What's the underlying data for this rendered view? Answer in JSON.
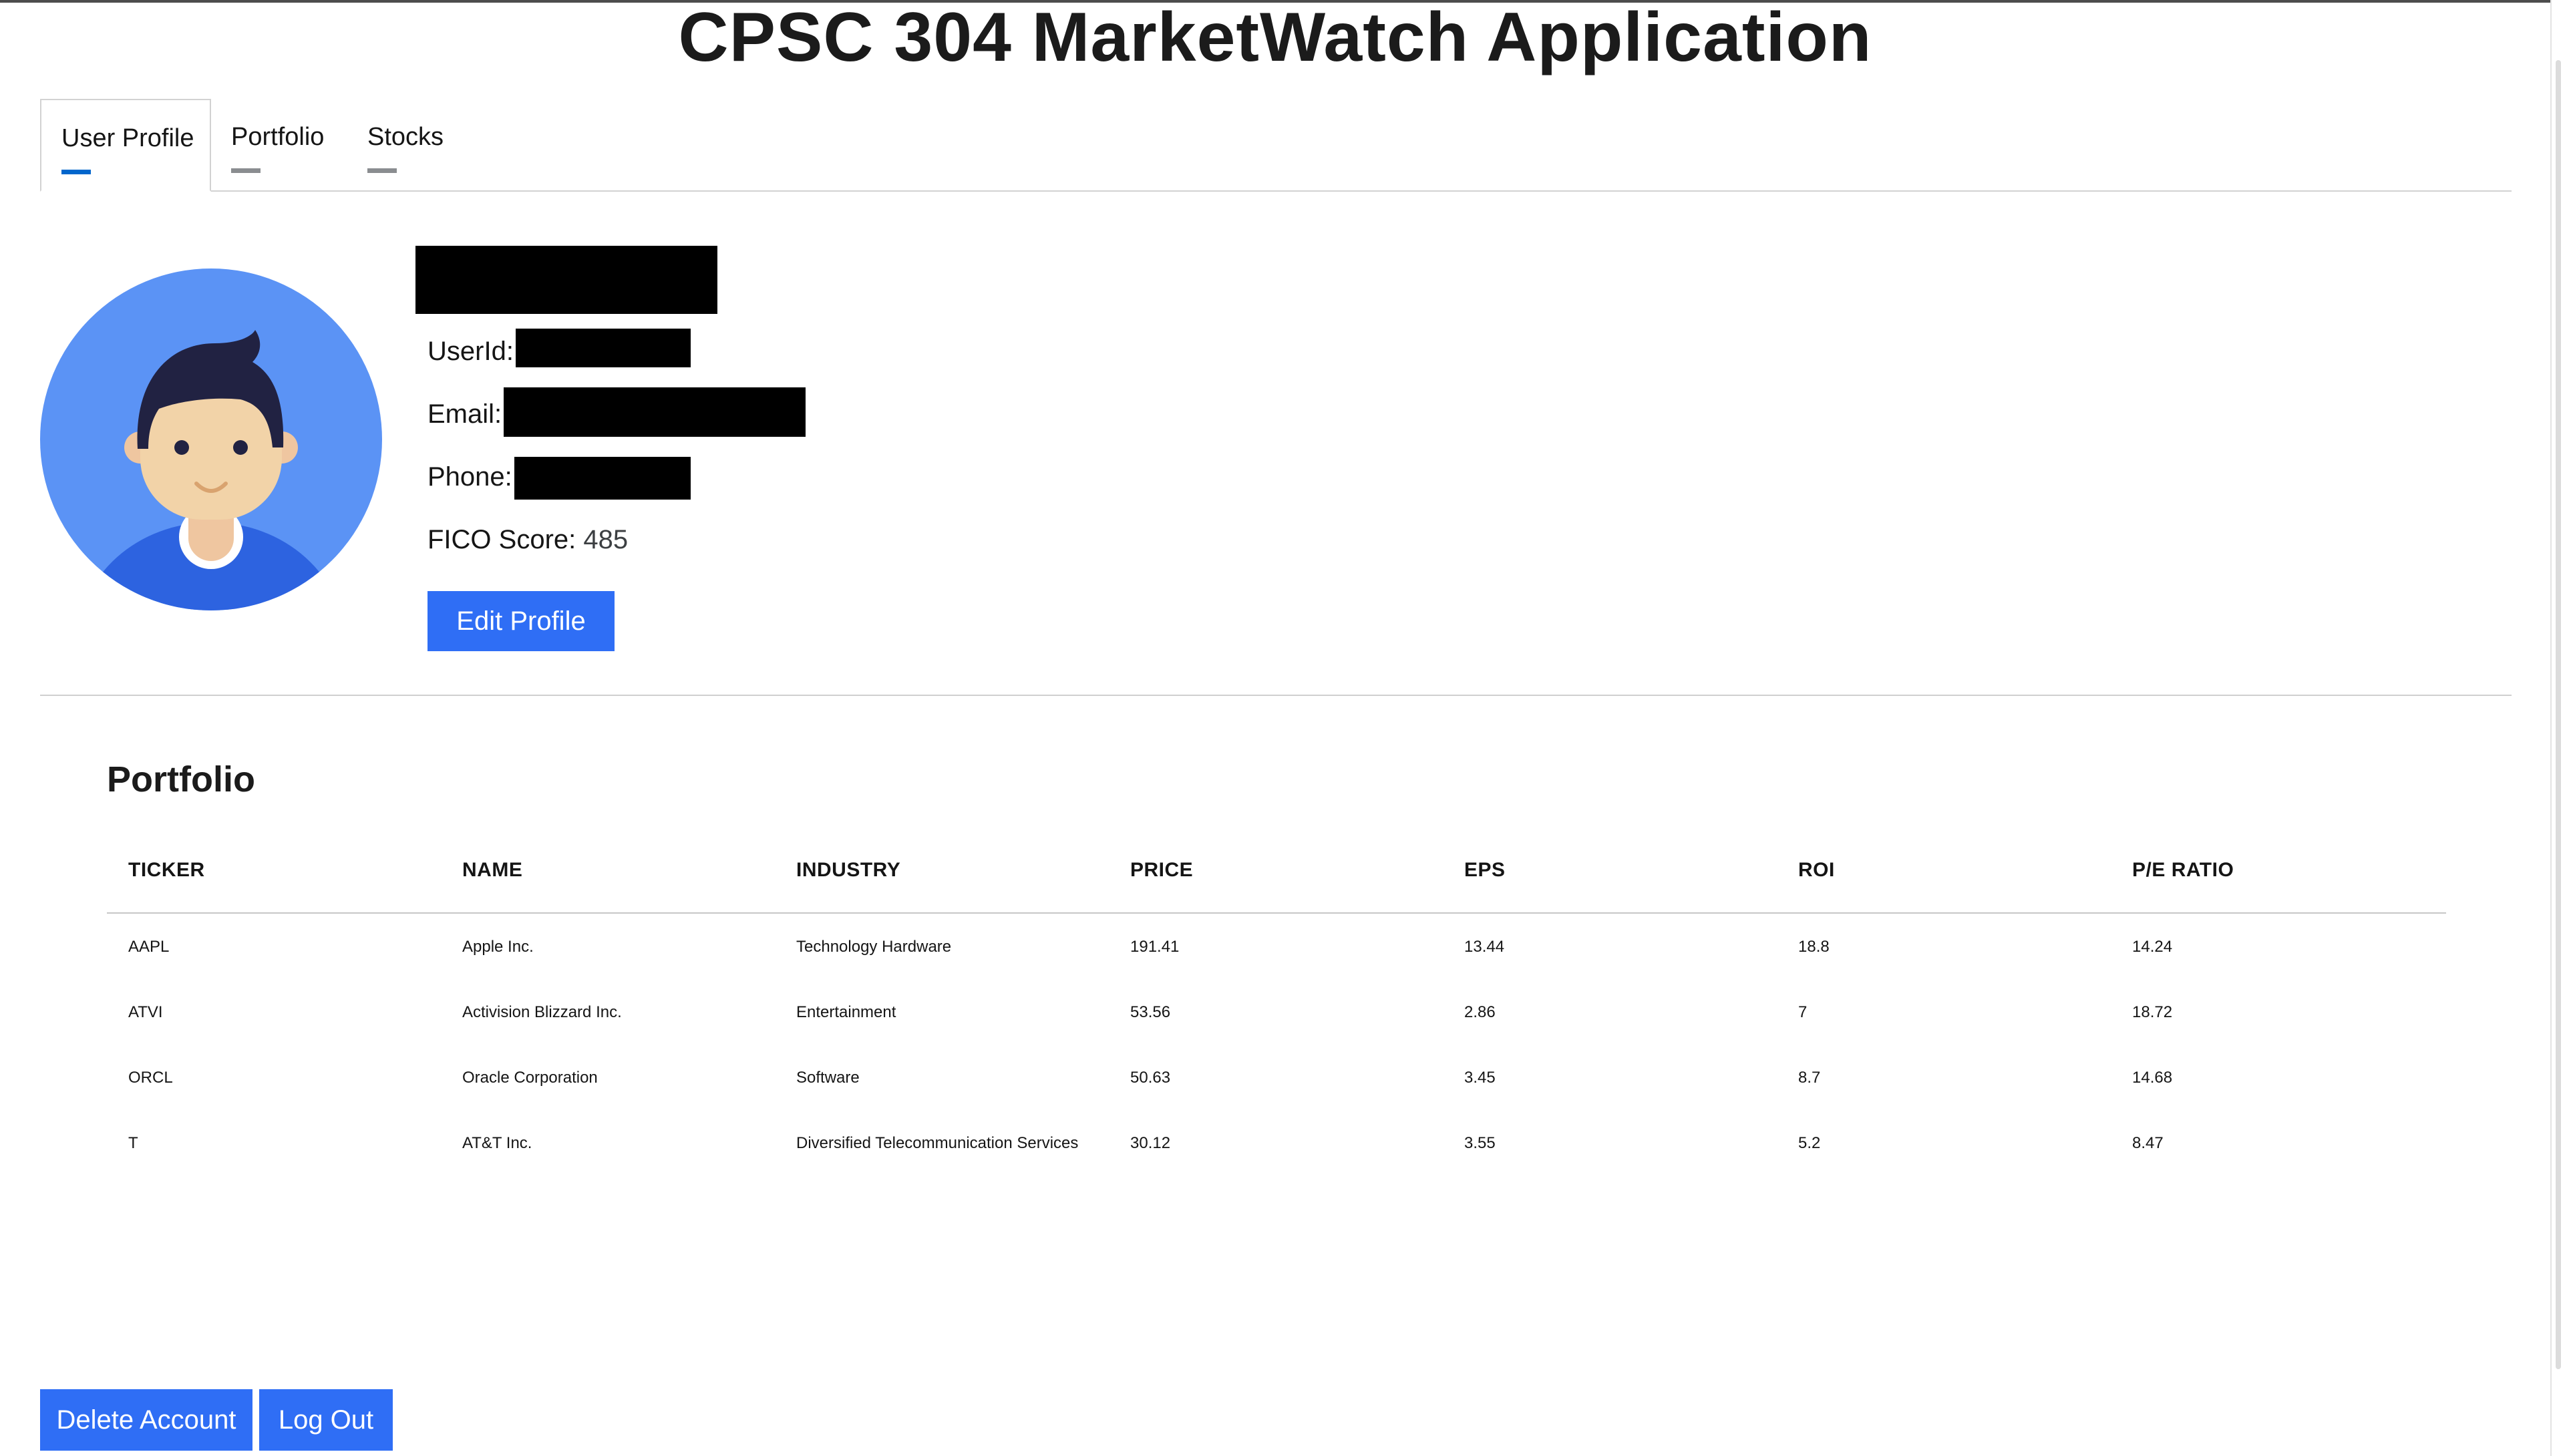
{
  "app": {
    "title": "CPSC 304 MarketWatch Application"
  },
  "tabs": [
    {
      "label": "User Profile",
      "active": true
    },
    {
      "label": "Portfolio",
      "active": false
    },
    {
      "label": "Stocks",
      "active": false
    }
  ],
  "profile": {
    "userid_label": "UserId:",
    "email_label": "Email:",
    "phone_label": "Phone:",
    "fico_label": "FICO Score:",
    "fico_value": "485",
    "edit_button": "Edit Profile"
  },
  "portfolio": {
    "title": "Portfolio",
    "columns": [
      "TICKER",
      "NAME",
      "INDUSTRY",
      "PRICE",
      "EPS",
      "ROI",
      "P/E RATIO"
    ],
    "rows": [
      [
        "AAPL",
        "Apple Inc.",
        "Technology Hardware",
        "191.41",
        "13.44",
        "18.8",
        "14.24"
      ],
      [
        "ATVI",
        "Activision Blizzard Inc.",
        "Entertainment",
        "53.56",
        "2.86",
        "7",
        "18.72"
      ],
      [
        "ORCL",
        "Oracle Corporation",
        "Software",
        "50.63",
        "3.45",
        "8.7",
        "14.68"
      ],
      [
        "T",
        "AT&T Inc.",
        "Diversified Telecommunication Services",
        "30.12",
        "3.55",
        "5.2",
        "8.47"
      ]
    ]
  },
  "footer": {
    "delete_button": "Delete Account",
    "logout_button": "Log Out"
  },
  "colors": {
    "primary_button": "#2f6ef5",
    "active_tab_indicator": "#0066cc",
    "inactive_tab_indicator": "#8a8d90",
    "avatar_background": "#5b93f5"
  }
}
